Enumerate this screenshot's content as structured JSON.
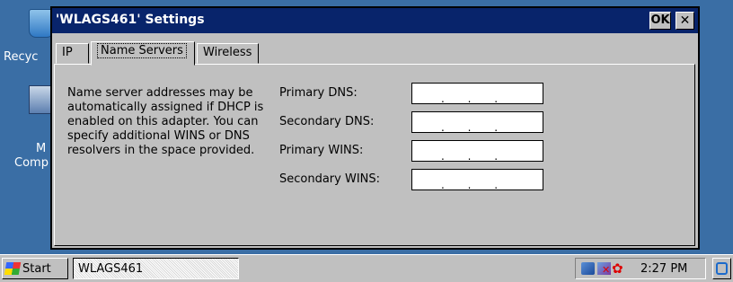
{
  "desktop": {
    "icons": [
      {
        "name": "recycle-bin",
        "label": "Recyc"
      },
      {
        "name": "my-computer",
        "label_line1": "M",
        "label_line2": "Comp"
      }
    ]
  },
  "dialog": {
    "title": "'WLAGS461' Settings",
    "ok_label": "OK",
    "close_label": "✕",
    "tabs": [
      {
        "label": "IP",
        "selected": false
      },
      {
        "label": "Name Servers",
        "selected": true
      },
      {
        "label": "Wireless",
        "selected": false
      }
    ],
    "description": "Name server addresses may be automatically assigned if DHCP is enabled on this adapter. You can specify additional WINS or DNS resolvers in the space provided.",
    "fields": [
      {
        "label": "Primary DNS:",
        "value": ". . ."
      },
      {
        "label": "Secondary DNS:",
        "value": ". . ."
      },
      {
        "label": "Primary WINS:",
        "value": ". . ."
      },
      {
        "label": "Secondary WINS:",
        "value": ". . ."
      }
    ]
  },
  "taskbar": {
    "start_label": "Start",
    "task_button_label": "WLAGS461",
    "clock": "2:27 PM"
  }
}
